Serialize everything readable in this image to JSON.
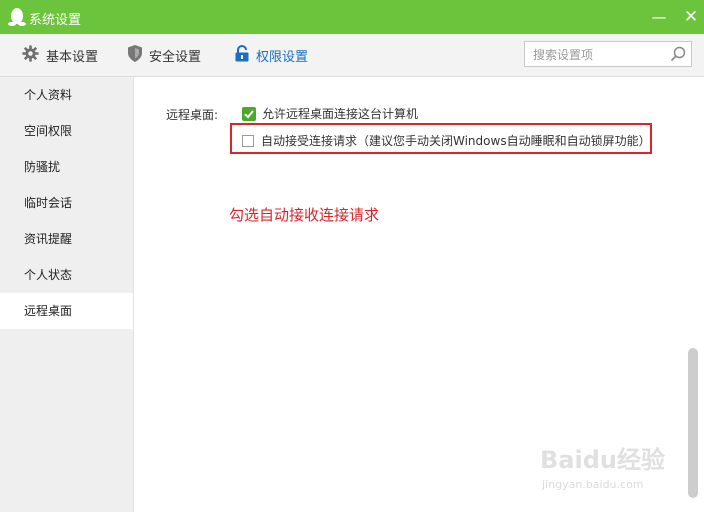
{
  "window": {
    "title": "系统设置",
    "minimize_glyph": "—",
    "close_glyph": "✕",
    "accent_color": "#6cc33c"
  },
  "toolbar": {
    "tabs": [
      {
        "label": "基本设置",
        "icon": "gear-icon",
        "active": false
      },
      {
        "label": "安全设置",
        "icon": "shield-icon",
        "active": false
      },
      {
        "label": "权限设置",
        "icon": "lock-icon",
        "active": true
      }
    ],
    "search": {
      "placeholder": "搜索设置项",
      "value": ""
    }
  },
  "sidebar": {
    "items": [
      {
        "label": "个人资料",
        "active": false
      },
      {
        "label": "空间权限",
        "active": false
      },
      {
        "label": "防骚扰",
        "active": false
      },
      {
        "label": "临时会话",
        "active": false
      },
      {
        "label": "资讯提醒",
        "active": false
      },
      {
        "label": "个人状态",
        "active": false
      },
      {
        "label": "远程桌面",
        "active": true
      }
    ]
  },
  "content": {
    "row_label": "远程桌面:",
    "options": [
      {
        "label": "允许远程桌面连接这台计算机",
        "checked": true
      },
      {
        "label": "自动接受连接请求（建议您手动关闭Windows自动睡眠和自动锁屏功能）",
        "checked": false
      }
    ],
    "annotation": "勾选自动接收连接请求",
    "highlight_color": "#d9262b"
  },
  "watermark": {
    "main": "Baidu经验",
    "sub": "jingyan.baidu.com"
  }
}
